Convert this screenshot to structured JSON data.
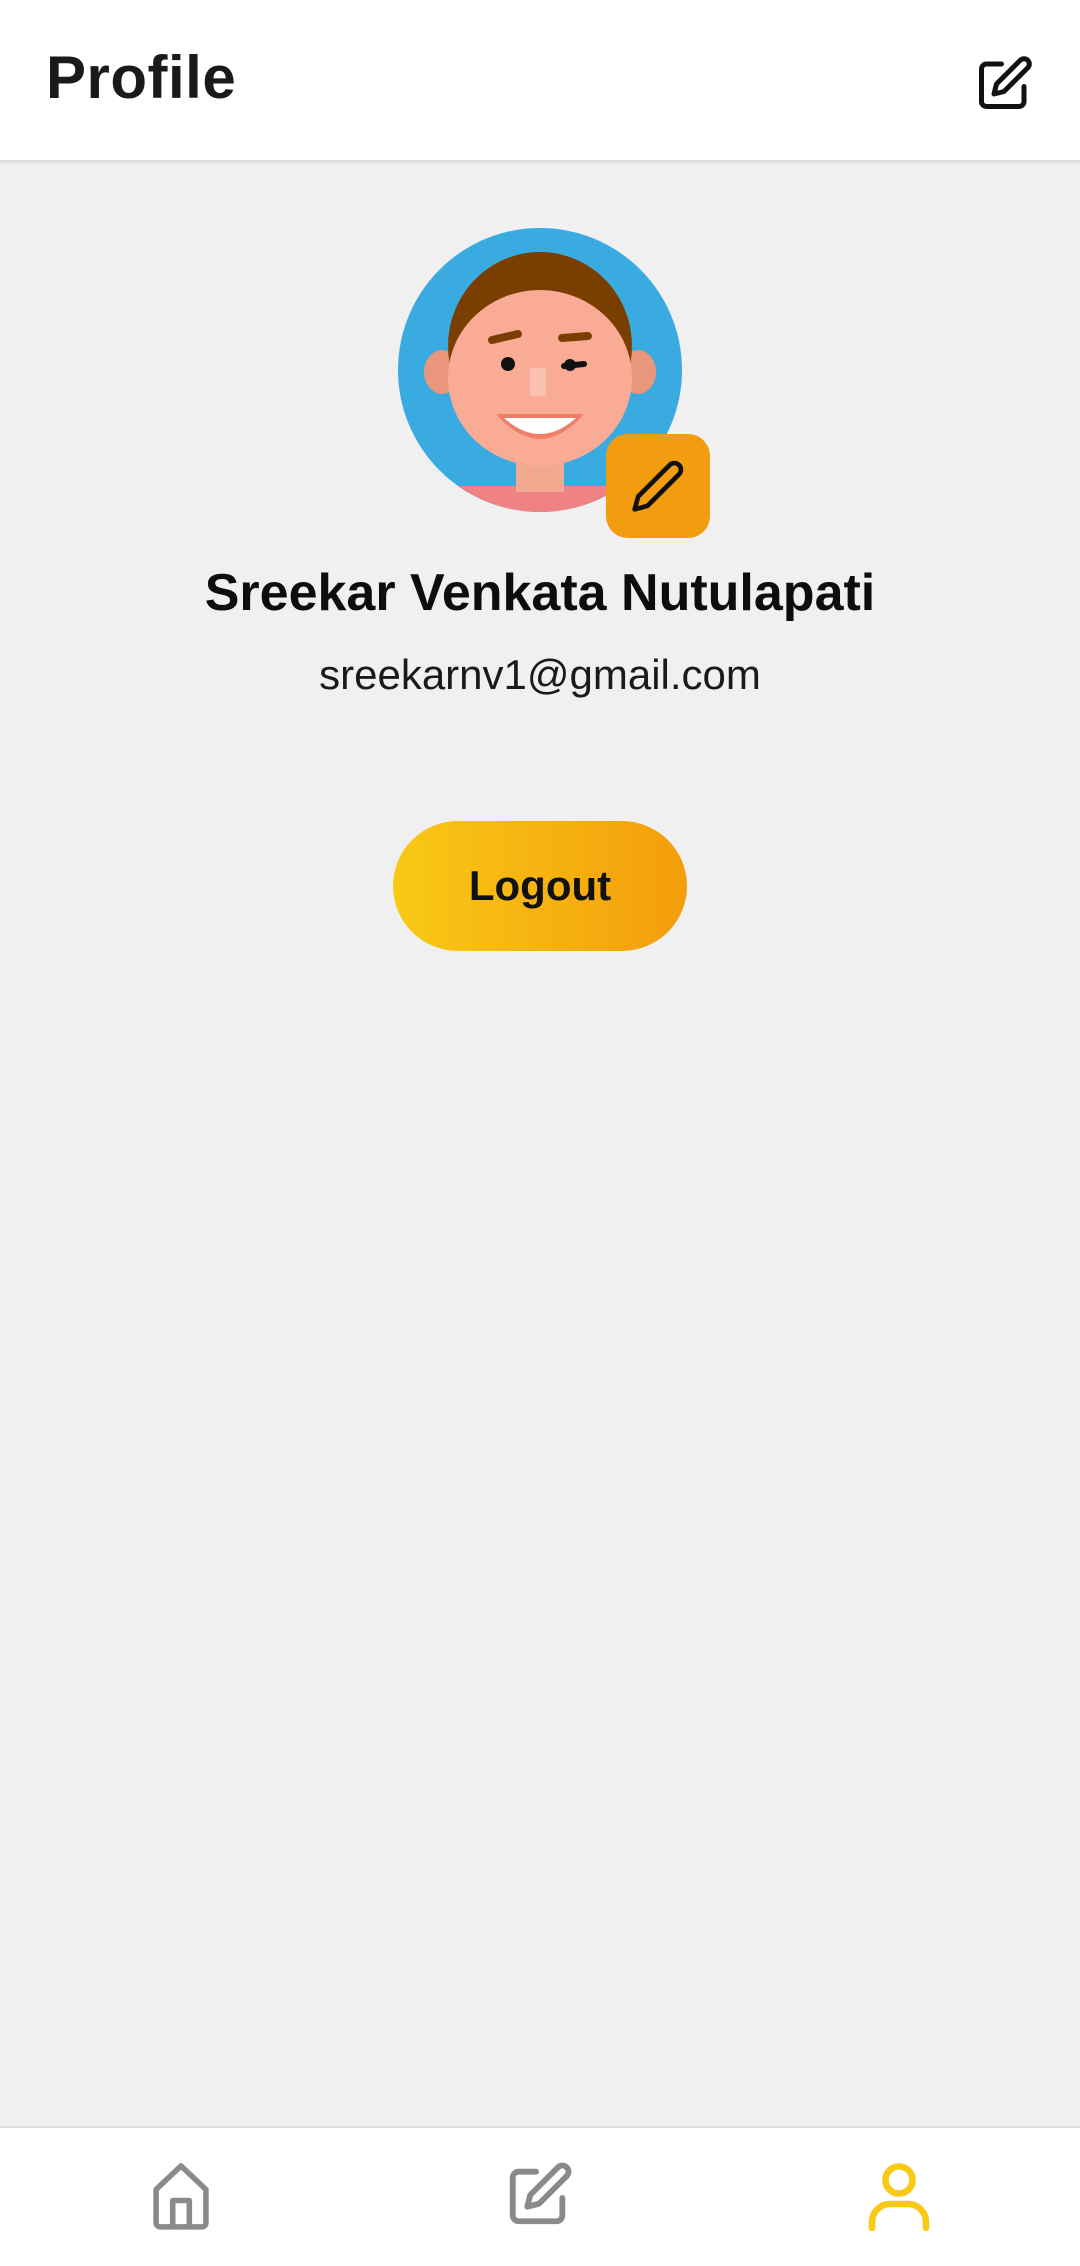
{
  "header": {
    "title": "Profile",
    "edit_icon": "edit-square-icon"
  },
  "profile": {
    "name": "Sreekar Venkata Nutulapati",
    "email": "sreekarnv1@gmail.com",
    "avatar_icon": "smiling-boy-avatar",
    "avatar_edit_icon": "pencil-icon"
  },
  "actions": {
    "logout_label": "Logout"
  },
  "bottom_nav": {
    "items": [
      {
        "icon": "home-icon",
        "active": false
      },
      {
        "icon": "edit-icon",
        "active": false
      },
      {
        "icon": "user-icon",
        "active": true
      }
    ]
  },
  "colors": {
    "accent": "#f8c915",
    "accent_dark": "#f29c0f",
    "avatar_bg": "#3aabe0",
    "nav_inactive": "#8a8a8a",
    "nav_active": "#f8c915"
  }
}
